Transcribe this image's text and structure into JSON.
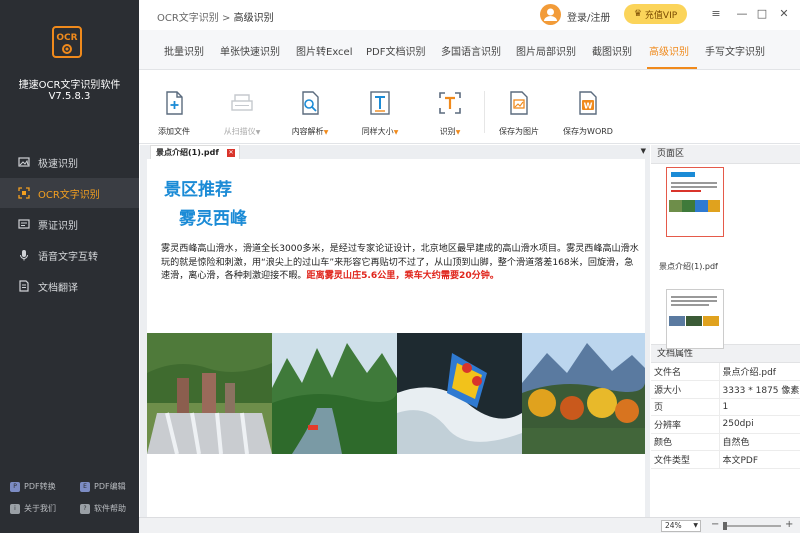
{
  "app": {
    "logo_text": "OCR",
    "name": "捷速OCR文字识别软件",
    "version": "V7.5.8.3"
  },
  "breadcrumb": {
    "root": "OCR文字识别",
    "sep": ">",
    "current": "高级识别"
  },
  "header": {
    "login": "登录/注册",
    "vip": "充值VIP"
  },
  "sidebar": {
    "items": [
      {
        "label": "极速识别",
        "icon": "image-icon"
      },
      {
        "label": "OCR文字识别",
        "icon": "ocr-frame-icon",
        "active": true
      },
      {
        "label": "票证识别",
        "icon": "card-icon"
      },
      {
        "label": "语音文字互转",
        "icon": "microphone-icon"
      },
      {
        "label": "文档翻译",
        "icon": "document-icon"
      }
    ],
    "footer": [
      {
        "label": "PDF转换",
        "icon": "pdf-convert-icon"
      },
      {
        "label": "PDF编辑",
        "icon": "pdf-edit-icon"
      },
      {
        "label": "关于我们",
        "icon": "info-icon"
      },
      {
        "label": "软件帮助",
        "icon": "help-icon"
      }
    ]
  },
  "tabs": [
    "批量识别",
    "单张快速识别",
    "图片转Excel",
    "PDF文档识别",
    "多国语言识别",
    "图片局部识别",
    "截图识别",
    "高级识别",
    "手写文字识别"
  ],
  "active_tab": "高级识别",
  "toolbar": [
    {
      "label": "添加文件",
      "icon": "add-file-icon"
    },
    {
      "label": "从扫描仪",
      "icon": "scanner-icon",
      "disabled": true,
      "caret": "▼"
    },
    {
      "label": "内容解析",
      "icon": "content-parse-icon",
      "caret": "▼"
    },
    {
      "label": "同样大小",
      "icon": "same-size-icon",
      "caret": "▼"
    },
    {
      "label": "识别",
      "icon": "recognize-icon",
      "caret": "▼"
    },
    {
      "label": "保存为图片",
      "icon": "save-image-icon"
    },
    {
      "label": "保存为WORD",
      "icon": "save-word-icon"
    }
  ],
  "document": {
    "tab_name": "景点介绍(1).pdf",
    "title1": "景区推荐",
    "title2": "雾灵西峰",
    "body": "雾灵西峰高山滑水，滑道全长3000多米，是经过专家论证设计，北京地区最早建成的高山滑水项目。雾灵西峰高山滑水玩的就是惊险和刺激，用“浪尖上的过山车”来形容它再贴切不过了，从山顶到山脚，整个滑道落差168米，回旋滑，急速滑，离心滑，各种刺激迎接不暇。",
    "body_red": "距离雾灵山庄5.6公里，乘车大约需要20分钟。"
  },
  "page_panel": {
    "title": "页面区",
    "thumb_label": "景点介绍(1).pdf"
  },
  "doc_props": {
    "title": "文档属性",
    "rows": [
      {
        "k": "文件名",
        "v": "景点介绍.pdf"
      },
      {
        "k": "源大小",
        "v": "3333 * 1875 像素"
      },
      {
        "k": "页",
        "v": "1"
      },
      {
        "k": "分辨率",
        "v": "250dpi"
      },
      {
        "k": "颜色",
        "v": "自然色"
      },
      {
        "k": "文件类型",
        "v": "本文PDF"
      }
    ]
  },
  "status": {
    "zoom": "24%"
  },
  "colors": {
    "accent": "#f08a1c",
    "sidebar_bg": "#2b2e33",
    "title_blue": "#1b8bd6",
    "red_text": "#e0261d"
  }
}
